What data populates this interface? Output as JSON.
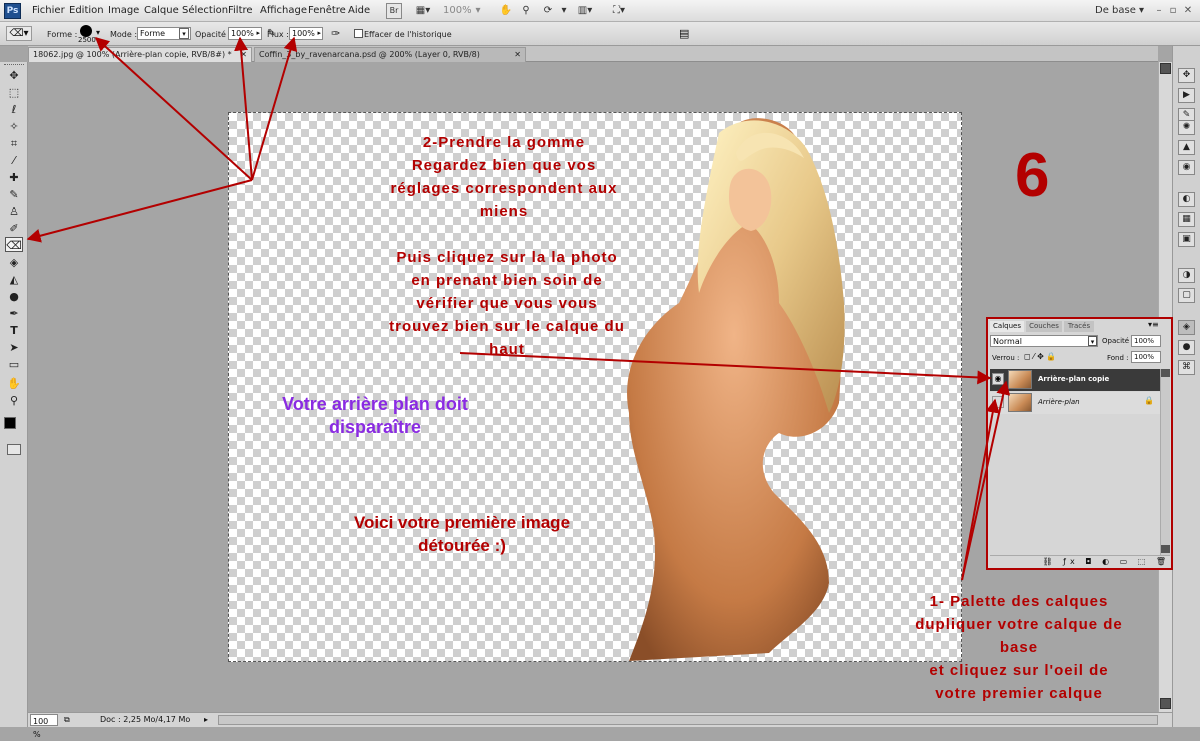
{
  "app": {
    "logo": "Ps"
  },
  "menu": [
    "Fichier",
    "Edition",
    "Image",
    "Calque",
    "Sélection",
    "Filtre",
    "Affichage",
    "Fenêtre",
    "Aide"
  ],
  "toolbar": {
    "br": "Br",
    "zoom": "100%",
    "workspace": "De base"
  },
  "options": {
    "forme_label": "Forme :",
    "brush_size": "2500",
    "mode_label": "Mode :",
    "mode_value": "Forme",
    "opacite_label": "Opacité :",
    "opacite_value": "100%",
    "flux_label": "Flux :",
    "flux_value": "100%",
    "historique_label": "Effacer de l'historique"
  },
  "tabs": [
    {
      "label": "18062.jpg @ 100% (Arrière-plan copie, RVB/8#) *"
    },
    {
      "label": "Coffin_3_by_ravenarcana.psd @ 200% (Layer 0, RVB/8)"
    }
  ],
  "annotations": {
    "step2": [
      "2-Prendre la gomme",
      "Regardez bien que vos",
      "réglages correspondent aux",
      "miens"
    ],
    "click": [
      "Puis cliquez sur la la photo",
      "en prenant bien soin de",
      "vérifier que vous vous",
      "trouvez bien sur le calque du",
      "haut"
    ],
    "disappear": [
      "Votre arrière plan doit",
      "disparaître"
    ],
    "result": [
      "Voici votre première image",
      "détourée :)"
    ],
    "step1": [
      "1- Palette des calques",
      "dupliquer votre calque de",
      "base",
      "et cliquez sur l'oeil de",
      "votre premier calque"
    ],
    "number": "6"
  },
  "layers": {
    "tabs": [
      "Calques",
      "Couches",
      "Tracés"
    ],
    "blend": "Normal",
    "opacite_label": "Opacité :",
    "opacite_value": "100%",
    "verrou_label": "Verrou :",
    "fond_label": "Fond :",
    "fond_value": "100%",
    "items": [
      {
        "name": "Arrière-plan copie"
      },
      {
        "name": "Arrière-plan"
      }
    ]
  },
  "status": {
    "zoom": "100 %",
    "doc": "Doc : 2,25 Mo/4,17 Mo"
  },
  "colors": {
    "annotation_red": "#b30000",
    "purple": "#8a2be2",
    "selected_layer": "#3a3a3a"
  }
}
